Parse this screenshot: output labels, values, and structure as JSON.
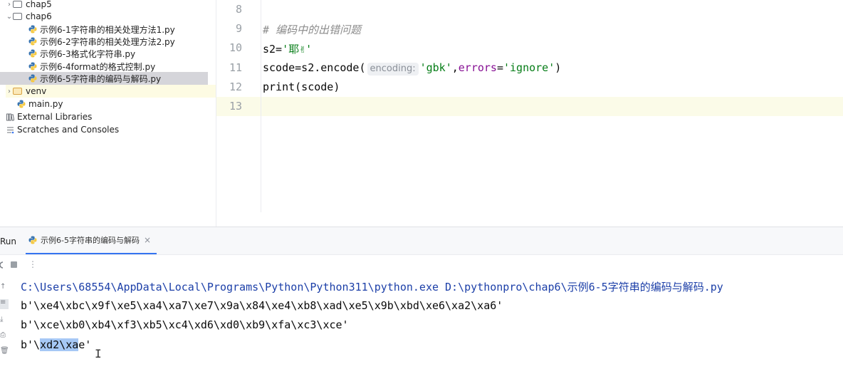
{
  "project_tree": [
    {
      "label": "chap5",
      "type": "folder",
      "expanded": false
    },
    {
      "label": "chap6",
      "type": "folder",
      "expanded": true
    },
    {
      "label": "示例6-1字符串的相关处理方法1.py",
      "type": "python-file"
    },
    {
      "label": "示例6-2字符串的相关处理方法2.py",
      "type": "python-file"
    },
    {
      "label": "示例6-3格式化字符串.py",
      "type": "python-file"
    },
    {
      "label": "示例6-4format的格式控制.py",
      "type": "python-file"
    },
    {
      "label": "示例6-5字符串的编码与解码.py",
      "type": "python-file",
      "selected": true
    },
    {
      "label": "venv",
      "type": "folder",
      "expanded": false
    },
    {
      "label": "main.py",
      "type": "python-file"
    },
    {
      "label": "External Libraries",
      "type": "library"
    },
    {
      "label": "Scratches and Consoles",
      "type": "scratches"
    }
  ],
  "editor": {
    "line_numbers": [
      "8",
      "9",
      "10",
      "11",
      "12",
      "13"
    ],
    "line9_comment": "# 编码中的出错问题",
    "line10": {
      "var": "s2=",
      "str": "'耶✌'"
    },
    "line11": {
      "pre": "scode=s2.encode(",
      "hint": "encoding:",
      "str1": "'gbk'",
      "mid": ",",
      "kwarg": "errors",
      "eq": "=",
      "str2": "'ignore'",
      "post": ")"
    },
    "line12": "print(scode)"
  },
  "run_panel": {
    "label": "Run",
    "tab_label": "示例6-5字符串的编码与解码",
    "close_icon": "×",
    "output": [
      "C:\\Users\\68554\\AppData\\Local\\Programs\\Python\\Python311\\python.exe D:\\pythonpro\\chap6\\示例6-5字符串的编码与解码.py",
      "b'\\xe4\\xbc\\x9f\\xe5\\xa4\\xa7\\xe7\\x9a\\x84\\xe4\\xb8\\xad\\xe5\\x9b\\xbd\\xe6\\xa2\\xa6'",
      "b'\\xce\\xb0\\xb4\\xf3\\xb5\\xc4\\xd6\\xd0\\xb9\\xfa\\xc3\\xce'"
    ],
    "last_line": {
      "prefix": "b'\\",
      "selected": "xd2\\xa",
      "suffix": "e'"
    }
  },
  "colors": {
    "accent": "#3574f0",
    "string": "#067d17",
    "keyword": "#871094",
    "comment": "#8c8c8c",
    "path": "#1c3fa8"
  }
}
